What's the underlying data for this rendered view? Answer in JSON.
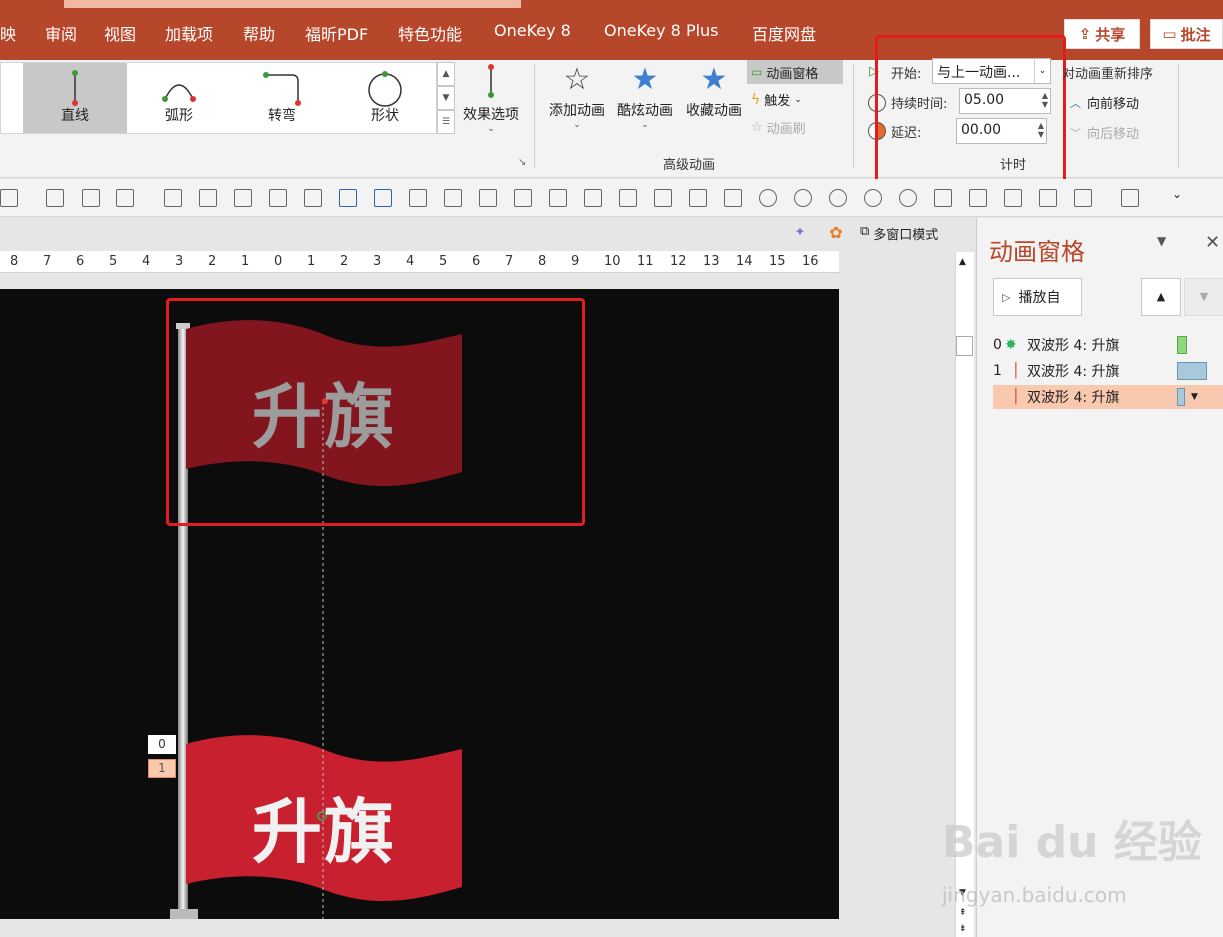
{
  "tabs": [
    "映",
    "审阅",
    "视图",
    "加载项",
    "帮助",
    "福昕PDF",
    "特色功能",
    "OneKey 8",
    "OneKey 8 Plus",
    "百度网盘"
  ],
  "top_buttons": {
    "share": "共享",
    "comment": "批注"
  },
  "gallery_items": [
    "直线",
    "弧形",
    "转弯",
    "形状"
  ],
  "effect_options": "效果选项",
  "advanced": {
    "add_animation": "添加动画",
    "cool_animation": "酷炫动画",
    "favorite_animation": "收藏动画",
    "animation_pane": "动画窗格",
    "trigger": "触发",
    "animation_painter": "动画刷",
    "group_label": "高级动画"
  },
  "timing": {
    "start_label": "开始:",
    "start_value": "与上一动画...",
    "duration_label": "持续时间:",
    "duration_value": "05.00",
    "delay_label": "延迟:",
    "delay_value": "00.00",
    "group_label": "计时"
  },
  "reorder": {
    "title": "对动画重新排序",
    "move_earlier": "向前移动",
    "move_later": "向后移动"
  },
  "view_bar": {
    "multi_window": "多窗口模式"
  },
  "ruler_labels": [
    "8",
    "7",
    "6",
    "5",
    "4",
    "3",
    "2",
    "1",
    "0",
    "1",
    "2",
    "3",
    "4",
    "5",
    "6",
    "7",
    "8",
    "9",
    "10",
    "11",
    "12",
    "13",
    "14",
    "15",
    "16"
  ],
  "slide": {
    "flag_text": "升旗",
    "tag_0": "0",
    "tag_1": "1"
  },
  "pane": {
    "title": "动画窗格",
    "play_from": "播放自",
    "items": [
      {
        "index": "0",
        "label": "双波形 4: 升旗"
      },
      {
        "index": "1",
        "label": "双波形 4: 升旗"
      },
      {
        "index": "",
        "label": "双波形 4: 升旗"
      }
    ]
  },
  "watermark": {
    "brand": "Bai du 经验",
    "url": "jingyan.baidu.com"
  },
  "colors": {
    "accent": "#b7472a",
    "flag": "#c8202f",
    "highlight_box": "#e31d1d",
    "selected_row": "#f8c9ae"
  }
}
